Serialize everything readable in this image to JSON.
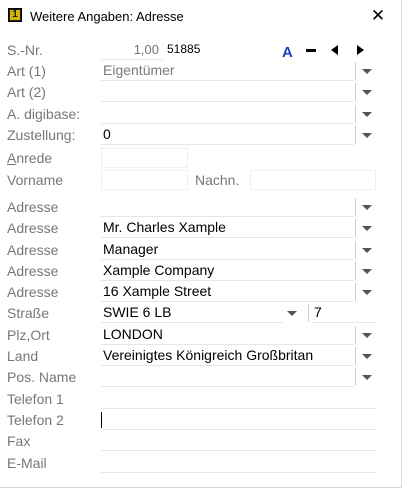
{
  "window": {
    "title": "Weitere Angaben: Adresse",
    "app_icon_char": "1",
    "close_glyph": "✕"
  },
  "snr": {
    "label": "S.-Nr.",
    "value": "1,00",
    "id": "51885"
  },
  "nav": {
    "font_label": "A"
  },
  "fields": {
    "art1": {
      "label": "Art (1)",
      "value": "Eigentümer"
    },
    "art2": {
      "label": "Art (2)",
      "value": ""
    },
    "digibase": {
      "label": "A. digibase:",
      "value": ""
    },
    "zustellung": {
      "label": "Zustellung:",
      "value": "0"
    },
    "anrede": {
      "label": "Anrede",
      "value": ""
    },
    "vorname": {
      "label": "Vorname",
      "value": ""
    },
    "nachn": {
      "label": "Nachn.",
      "value": ""
    },
    "adresse1": {
      "label": "Adresse",
      "value": ""
    },
    "adresse2": {
      "label": "Adresse",
      "value": "Mr. Charles Xample"
    },
    "adresse3": {
      "label": "Adresse",
      "value": "Manager"
    },
    "adresse4": {
      "label": "Adresse",
      "value": "Xample Company"
    },
    "adresse5": {
      "label": "Adresse",
      "value": "16 Xample Street"
    },
    "strasse": {
      "label": "Straße",
      "value": "SWIE 6 LB",
      "number": "7"
    },
    "plzort": {
      "label": "Plz,Ort",
      "value": "LONDON"
    },
    "land": {
      "label": "Land",
      "value": "Vereinigtes Königreich Großbritan"
    },
    "posname": {
      "label": "Pos. Name",
      "value": ""
    },
    "telefon1": {
      "label": "Telefon 1",
      "value": ""
    },
    "telefon2": {
      "label": "Telefon 2",
      "value": ""
    },
    "fax": {
      "label": "Fax",
      "value": ""
    },
    "email": {
      "label": "E-Mail",
      "value": ""
    }
  }
}
